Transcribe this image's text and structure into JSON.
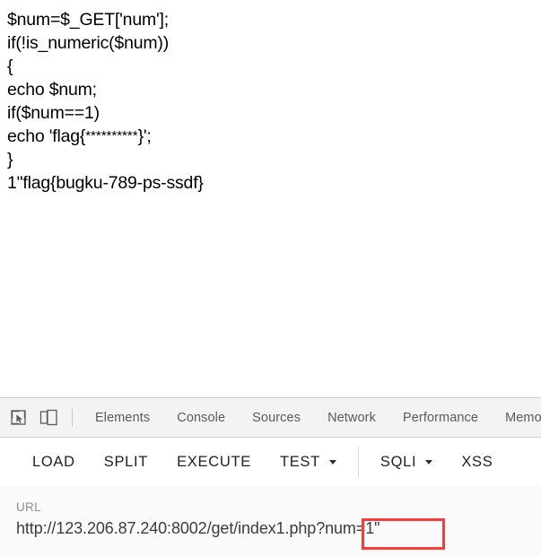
{
  "page_content": {
    "lines": [
      {
        "text": "$num=$_GET['num'];"
      },
      {
        "text": "if(!is_numeric($num))"
      },
      {
        "text": "{"
      },
      {
        "text": "echo $num;"
      },
      {
        "text": "if($num==1)"
      },
      {
        "pre": "echo 'flag{",
        "stars": "**********",
        "post": "}';"
      },
      {
        "text": "}"
      },
      {
        "text": "1\"flag{bugku-789-ps-ssdf}"
      }
    ],
    "line_0": "$num=$_GET['num'];",
    "line_1": "if(!is_numeric($num))",
    "line_2": "{",
    "line_3": "echo $num;",
    "line_4": "if($num==1)",
    "line_5_pre": "echo 'flag{",
    "line_5_stars": "**********",
    "line_5_post": "}';",
    "line_6": "}",
    "line_7": "1\"flag{bugku-789-ps-ssdf}"
  },
  "devtools": {
    "icons": {
      "inspect": "inspect-element-icon",
      "device": "device-toolbar-icon"
    },
    "tabs": [
      {
        "label": "Elements",
        "active": false
      },
      {
        "label": "Console",
        "active": false
      },
      {
        "label": "Sources",
        "active": false
      },
      {
        "label": "Network",
        "active": false
      },
      {
        "label": "Performance",
        "active": false
      },
      {
        "label": "Memory",
        "active": false
      }
    ],
    "tab_0": "Elements",
    "tab_1": "Console",
    "tab_2": "Sources",
    "tab_3": "Network",
    "tab_4": "Performance",
    "tab_5": "Memory",
    "background": "#f3f3f3"
  },
  "hackbar": {
    "buttons": [
      {
        "label": "LOAD",
        "has_caret": false
      },
      {
        "label": "SPLIT",
        "has_caret": false
      },
      {
        "label": "EXECUTE",
        "has_caret": false
      },
      {
        "label": "TEST",
        "has_caret": true
      },
      {
        "label": "SQLI",
        "has_caret": true
      },
      {
        "label": "XSS",
        "has_caret": false
      }
    ],
    "btn_0": "LOAD",
    "btn_1": "SPLIT",
    "btn_2": "EXECUTE",
    "btn_3": "TEST",
    "btn_4": "SQLI",
    "btn_5": "XSS",
    "background": "#ffffff"
  },
  "url_panel": {
    "label": "URL",
    "value": "http://123.206.87.240:8002/get/index1.php?num=1\"",
    "background": "#fafafa"
  },
  "annotation": {
    "color": "#f93b3b",
    "highlighted_text": "?num=1\""
  }
}
